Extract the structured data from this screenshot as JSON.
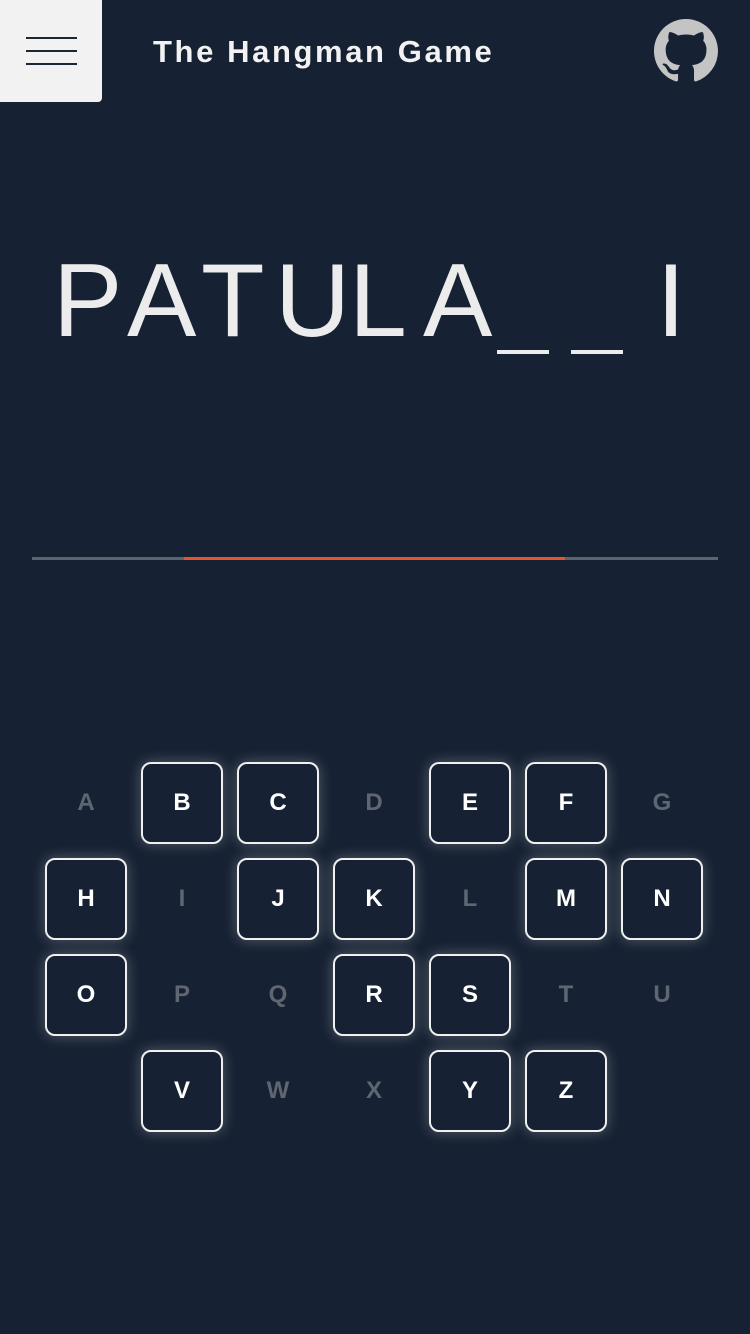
{
  "header": {
    "title": "The Hangman Game",
    "menu_icon": "hamburger-menu-icon",
    "github_icon": "github-icon"
  },
  "word": {
    "slots": [
      "P",
      "A",
      "T",
      "U",
      "L",
      "A",
      "",
      "",
      "I"
    ]
  },
  "progress": {
    "start_fraction": 0.222,
    "end_fraction": 0.778,
    "track_color": "#5c6470",
    "fill_color": "#e4572e"
  },
  "keyboard": {
    "rows": [
      [
        {
          "letter": "A",
          "used": true
        },
        {
          "letter": "B",
          "used": false
        },
        {
          "letter": "C",
          "used": false
        },
        {
          "letter": "D",
          "used": true
        },
        {
          "letter": "E",
          "used": false
        },
        {
          "letter": "F",
          "used": false
        },
        {
          "letter": "G",
          "used": true
        }
      ],
      [
        {
          "letter": "H",
          "used": false
        },
        {
          "letter": "I",
          "used": true
        },
        {
          "letter": "J",
          "used": false
        },
        {
          "letter": "K",
          "used": false
        },
        {
          "letter": "L",
          "used": true
        },
        {
          "letter": "M",
          "used": false
        },
        {
          "letter": "N",
          "used": false
        }
      ],
      [
        {
          "letter": "O",
          "used": false
        },
        {
          "letter": "P",
          "used": true
        },
        {
          "letter": "Q",
          "used": true
        },
        {
          "letter": "R",
          "used": false
        },
        {
          "letter": "S",
          "used": false
        },
        {
          "letter": "T",
          "used": true
        },
        {
          "letter": "U",
          "used": true
        }
      ],
      [
        {
          "letter": "V",
          "used": false
        },
        {
          "letter": "W",
          "used": true
        },
        {
          "letter": "X",
          "used": true
        },
        {
          "letter": "Y",
          "used": false
        },
        {
          "letter": "Z",
          "used": false
        }
      ]
    ]
  },
  "colors": {
    "background": "#162233",
    "text": "#f2f2f2",
    "disabled_key": "#5f6672"
  }
}
